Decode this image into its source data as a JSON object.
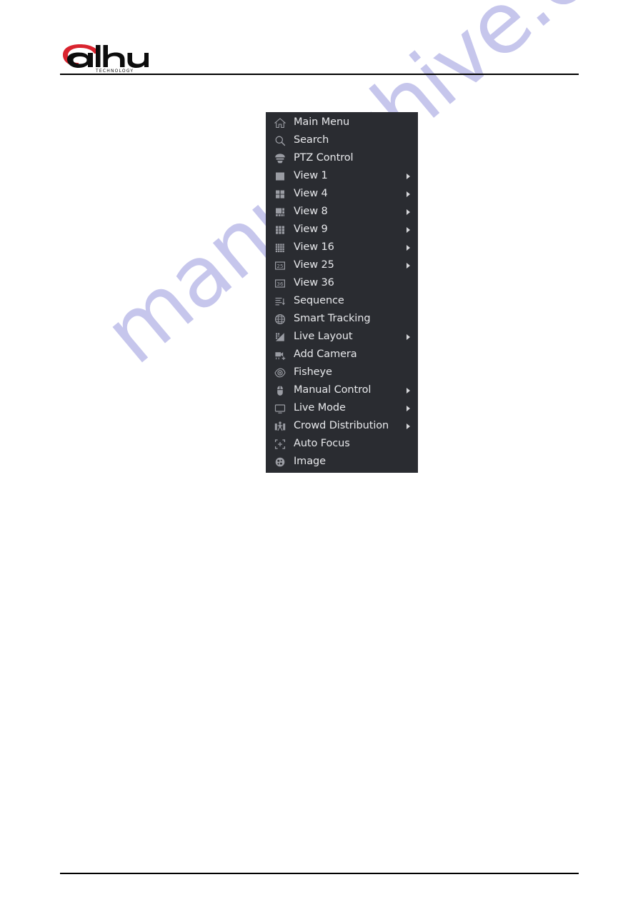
{
  "page": {
    "background_color": "#ffffff",
    "watermark_text": "manualshive.com",
    "watermark_color": "#c6c6ec"
  },
  "header": {
    "logo_wordmark": "alhua",
    "logo_brand": "dahua",
    "logo_subtitle": "TECHNOLOGY",
    "logo_accent_color": "#d9232e",
    "logo_text_color": "#000000",
    "rule_color": "#000000"
  },
  "menu": {
    "background_color": "#2a2c31",
    "text_color": "#e8e9ec",
    "icon_color": "#9a9ca3",
    "items": [
      {
        "label": "Main Menu",
        "icon": "home-icon",
        "has_submenu": false
      },
      {
        "label": "Search",
        "icon": "search-icon",
        "has_submenu": false
      },
      {
        "label": "PTZ Control",
        "icon": "ptz-dome-icon",
        "has_submenu": false
      },
      {
        "label": "View 1",
        "icon": "view-1-icon",
        "has_submenu": true
      },
      {
        "label": "View 4",
        "icon": "view-4-icon",
        "has_submenu": true
      },
      {
        "label": "View 8",
        "icon": "view-8-icon",
        "has_submenu": true
      },
      {
        "label": "View 9",
        "icon": "view-9-icon",
        "has_submenu": true
      },
      {
        "label": "View 16",
        "icon": "view-16-icon",
        "has_submenu": true
      },
      {
        "label": "View 25",
        "icon": "view-25-icon",
        "has_submenu": true
      },
      {
        "label": "View 36",
        "icon": "view-36-icon",
        "has_submenu": false
      },
      {
        "label": "Sequence",
        "icon": "sequence-icon",
        "has_submenu": false
      },
      {
        "label": "Smart Tracking",
        "icon": "smart-tracking-icon",
        "has_submenu": false
      },
      {
        "label": "Live Layout",
        "icon": "live-layout-icon",
        "has_submenu": true
      },
      {
        "label": "Add Camera",
        "icon": "add-camera-icon",
        "has_submenu": false
      },
      {
        "label": "Fisheye",
        "icon": "fisheye-eye-icon",
        "has_submenu": false
      },
      {
        "label": "Manual Control",
        "icon": "mouse-icon",
        "has_submenu": true
      },
      {
        "label": "Live Mode",
        "icon": "monitor-icon",
        "has_submenu": true
      },
      {
        "label": "Crowd Distribution",
        "icon": "crowd-distribution-icon",
        "has_submenu": true
      },
      {
        "label": "Auto Focus",
        "icon": "auto-focus-icon",
        "has_submenu": false
      },
      {
        "label": "Image",
        "icon": "aperture-icon",
        "has_submenu": false
      }
    ]
  }
}
